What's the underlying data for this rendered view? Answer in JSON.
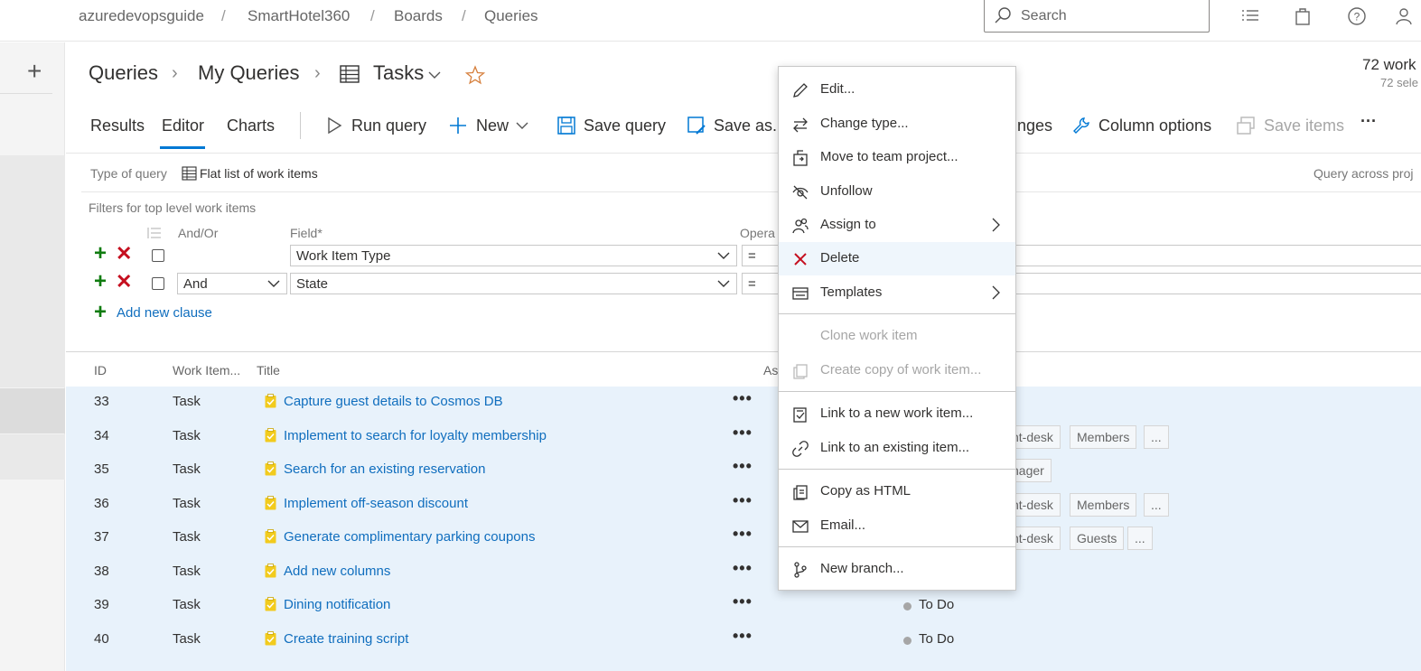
{
  "breadcrumb": [
    "azuredevopsguide",
    "SmartHotel360",
    "Boards",
    "Queries"
  ],
  "breadcrumb_sep": "/",
  "search": {
    "placeholder": "Search"
  },
  "header": {
    "crumbs": [
      "Queries",
      "My Queries",
      "Tasks"
    ],
    "count_main": "72 work",
    "count_sub": "72 sele"
  },
  "tabs": [
    "Results",
    "Editor",
    "Charts"
  ],
  "toolbar": {
    "run_query": "Run query",
    "new": "New",
    "save_query": "Save query",
    "save_as": "Save as...",
    "changes_partial": "nges",
    "column_options": "Column options",
    "save_items": "Save items",
    "more": "···"
  },
  "editor": {
    "type_label": "Type of query",
    "type_value": "Flat list of work items",
    "query_across": "Query across proj",
    "filters_label": "Filters for top level work items",
    "col_andor": "And/Or",
    "col_field": "Field*",
    "col_operator": "Opera",
    "clauses": [
      {
        "andor": "",
        "field": "Work Item Type",
        "operator": "="
      },
      {
        "andor": "And",
        "field": "State",
        "operator": "="
      }
    ],
    "add_clause": "Add new clause"
  },
  "grid": {
    "headers": {
      "id": "ID",
      "type": "Work Item...",
      "title": "Title",
      "assigned": "As"
    },
    "rows": [
      {
        "id": "33",
        "type": "Task",
        "title": "Capture guest details to Cosmos DB"
      },
      {
        "id": "34",
        "type": "Task",
        "title": "Implement to search for loyalty membership",
        "tags": [
          "nt-desk",
          "Members",
          "..."
        ]
      },
      {
        "id": "35",
        "type": "Task",
        "title": "Search for an existing reservation",
        "tags": [
          "nager"
        ]
      },
      {
        "id": "36",
        "type": "Task",
        "title": "Implement off-season discount",
        "tags": [
          "nt-desk",
          "Members",
          "..."
        ]
      },
      {
        "id": "37",
        "type": "Task",
        "title": "Generate complimentary parking coupons",
        "tags": [
          "nt-desk",
          "Guests",
          "..."
        ]
      },
      {
        "id": "38",
        "type": "Task",
        "title": "Add new columns"
      },
      {
        "id": "39",
        "type": "Task",
        "title": "Dining notification",
        "state": "To Do"
      },
      {
        "id": "40",
        "type": "Task",
        "title": "Create training script",
        "state": "To Do"
      }
    ]
  },
  "context_menu": {
    "items": [
      {
        "label": "Edit...",
        "icon": "pencil-icon"
      },
      {
        "label": "Change type...",
        "icon": "swap-arrows-icon"
      },
      {
        "label": "Move to team project...",
        "icon": "move-icon"
      },
      {
        "label": "Unfollow",
        "icon": "eye-slash-icon"
      },
      {
        "label": "Assign to",
        "icon": "people-icon"
      },
      {
        "label": "Delete",
        "icon": "delete-x-icon"
      },
      {
        "label": "Templates",
        "icon": "template-icon"
      },
      {
        "label": "Clone work item",
        "icon": ""
      },
      {
        "label": "Create copy of work item...",
        "icon": "copy-icon"
      },
      {
        "label": "Link to a new work item...",
        "icon": "link-new-icon"
      },
      {
        "label": "Link to an existing item...",
        "icon": "link-icon"
      },
      {
        "label": "Copy as HTML",
        "icon": "copy-html-icon"
      },
      {
        "label": "Email...",
        "icon": "mail-icon"
      },
      {
        "label": "New branch...",
        "icon": "branch-icon"
      }
    ]
  },
  "colors": {
    "accent": "#0078d4",
    "link": "#106ebe",
    "add_green": "#107c10",
    "delete_red": "#c50f1f",
    "task_yellow": "#f2cb1d"
  }
}
